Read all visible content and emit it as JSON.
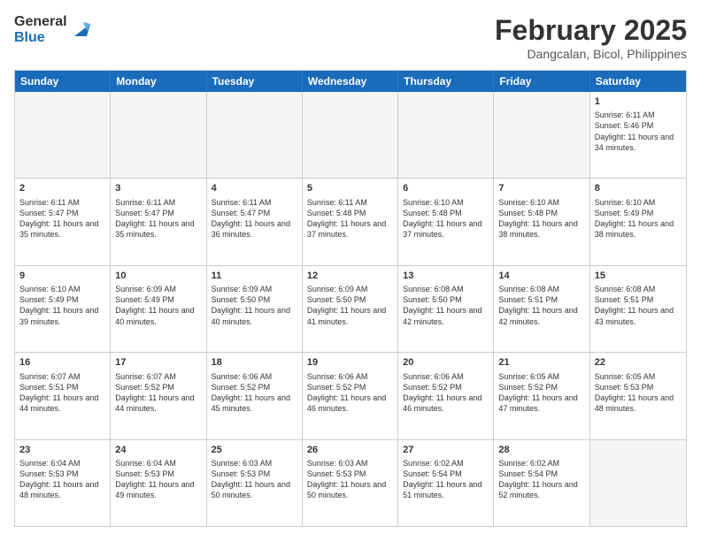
{
  "header": {
    "logo_general": "General",
    "logo_blue": "Blue",
    "month_title": "February 2025",
    "subtitle": "Dangcalan, Bicol, Philippines"
  },
  "days_of_week": [
    "Sunday",
    "Monday",
    "Tuesday",
    "Wednesday",
    "Thursday",
    "Friday",
    "Saturday"
  ],
  "weeks": [
    [
      {
        "day": "",
        "empty": true
      },
      {
        "day": "",
        "empty": true
      },
      {
        "day": "",
        "empty": true
      },
      {
        "day": "",
        "empty": true
      },
      {
        "day": "",
        "empty": true
      },
      {
        "day": "",
        "empty": true
      },
      {
        "day": "1",
        "sunrise": "6:11 AM",
        "sunset": "5:46 PM",
        "daylight": "11 hours and 34 minutes."
      }
    ],
    [
      {
        "day": "2",
        "sunrise": "6:11 AM",
        "sunset": "5:47 PM",
        "daylight": "11 hours and 35 minutes."
      },
      {
        "day": "3",
        "sunrise": "6:11 AM",
        "sunset": "5:47 PM",
        "daylight": "11 hours and 35 minutes."
      },
      {
        "day": "4",
        "sunrise": "6:11 AM",
        "sunset": "5:47 PM",
        "daylight": "11 hours and 36 minutes."
      },
      {
        "day": "5",
        "sunrise": "6:11 AM",
        "sunset": "5:48 PM",
        "daylight": "11 hours and 37 minutes."
      },
      {
        "day": "6",
        "sunrise": "6:10 AM",
        "sunset": "5:48 PM",
        "daylight": "11 hours and 37 minutes."
      },
      {
        "day": "7",
        "sunrise": "6:10 AM",
        "sunset": "5:48 PM",
        "daylight": "11 hours and 38 minutes."
      },
      {
        "day": "8",
        "sunrise": "6:10 AM",
        "sunset": "5:49 PM",
        "daylight": "11 hours and 38 minutes."
      }
    ],
    [
      {
        "day": "9",
        "sunrise": "6:10 AM",
        "sunset": "5:49 PM",
        "daylight": "11 hours and 39 minutes."
      },
      {
        "day": "10",
        "sunrise": "6:09 AM",
        "sunset": "5:49 PM",
        "daylight": "11 hours and 40 minutes."
      },
      {
        "day": "11",
        "sunrise": "6:09 AM",
        "sunset": "5:50 PM",
        "daylight": "11 hours and 40 minutes."
      },
      {
        "day": "12",
        "sunrise": "6:09 AM",
        "sunset": "5:50 PM",
        "daylight": "11 hours and 41 minutes."
      },
      {
        "day": "13",
        "sunrise": "6:08 AM",
        "sunset": "5:50 PM",
        "daylight": "11 hours and 42 minutes."
      },
      {
        "day": "14",
        "sunrise": "6:08 AM",
        "sunset": "5:51 PM",
        "daylight": "11 hours and 42 minutes."
      },
      {
        "day": "15",
        "sunrise": "6:08 AM",
        "sunset": "5:51 PM",
        "daylight": "11 hours and 43 minutes."
      }
    ],
    [
      {
        "day": "16",
        "sunrise": "6:07 AM",
        "sunset": "5:51 PM",
        "daylight": "11 hours and 44 minutes."
      },
      {
        "day": "17",
        "sunrise": "6:07 AM",
        "sunset": "5:52 PM",
        "daylight": "11 hours and 44 minutes."
      },
      {
        "day": "18",
        "sunrise": "6:06 AM",
        "sunset": "5:52 PM",
        "daylight": "11 hours and 45 minutes."
      },
      {
        "day": "19",
        "sunrise": "6:06 AM",
        "sunset": "5:52 PM",
        "daylight": "11 hours and 46 minutes."
      },
      {
        "day": "20",
        "sunrise": "6:06 AM",
        "sunset": "5:52 PM",
        "daylight": "11 hours and 46 minutes."
      },
      {
        "day": "21",
        "sunrise": "6:05 AM",
        "sunset": "5:52 PM",
        "daylight": "11 hours and 47 minutes."
      },
      {
        "day": "22",
        "sunrise": "6:05 AM",
        "sunset": "5:53 PM",
        "daylight": "11 hours and 48 minutes."
      }
    ],
    [
      {
        "day": "23",
        "sunrise": "6:04 AM",
        "sunset": "5:53 PM",
        "daylight": "11 hours and 48 minutes."
      },
      {
        "day": "24",
        "sunrise": "6:04 AM",
        "sunset": "5:53 PM",
        "daylight": "11 hours and 49 minutes."
      },
      {
        "day": "25",
        "sunrise": "6:03 AM",
        "sunset": "5:53 PM",
        "daylight": "11 hours and 50 minutes."
      },
      {
        "day": "26",
        "sunrise": "6:03 AM",
        "sunset": "5:53 PM",
        "daylight": "11 hours and 50 minutes."
      },
      {
        "day": "27",
        "sunrise": "6:02 AM",
        "sunset": "5:54 PM",
        "daylight": "11 hours and 51 minutes."
      },
      {
        "day": "28",
        "sunrise": "6:02 AM",
        "sunset": "5:54 PM",
        "daylight": "11 hours and 52 minutes."
      },
      {
        "day": "",
        "empty": true
      }
    ]
  ]
}
